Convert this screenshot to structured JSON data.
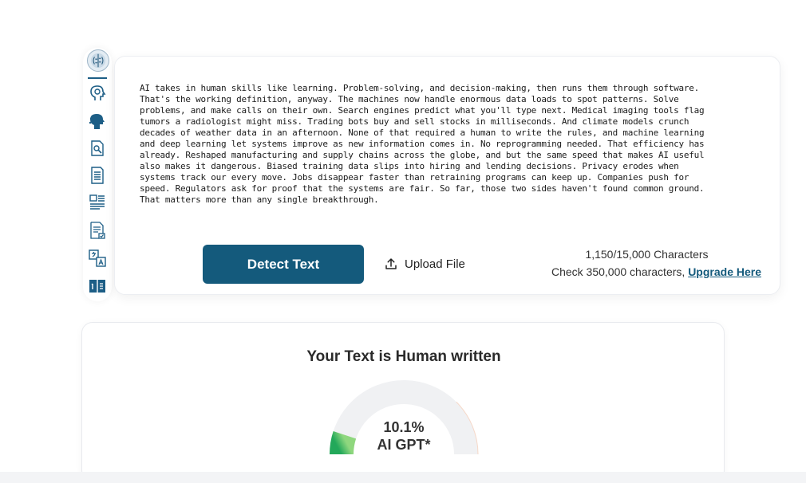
{
  "sidebar": {
    "icons": [
      {
        "name": "brain-logo-icon"
      },
      {
        "name": "ai-head-icon"
      },
      {
        "name": "humanize-icon"
      },
      {
        "name": "plagiarism-icon"
      },
      {
        "name": "document-icon"
      },
      {
        "name": "image-text-icon"
      },
      {
        "name": "document-check-icon"
      },
      {
        "name": "translate-icon"
      },
      {
        "name": "compare-icon"
      }
    ],
    "accent": "#145a7c"
  },
  "editor": {
    "text": "AI takes in human skills like learning. Problem-solving, and decision-making, then runs them through software.\nThat's the working definition, anyway. The machines now handle enormous data loads to spot patterns. Solve\nproblems, and make calls on their own. Search engines predict what you'll type next. Medical imaging tools flag\ntumors a radiologist might miss. Trading bots buy and sell stocks in milliseconds. And climate models crunch\ndecades of weather data in an afternoon. None of that required a human to write the rules, and machine learning\nand deep learning let systems improve as new information comes in. No reprogramming needed. That efficiency has\nalready. Reshaped manufacturing and supply chains across the globe, and but the same speed that makes AI useful\nalso makes it dangerous. Biased training data slips into hiring and lending decisions. Privacy erodes when\nsystems track our every move. Jobs disappear faster than retraining programs can keep up. Companies push for\nspeed. Regulators ask for proof that the systems are fair. So far, those two sides haven't found common ground.\nThat matters more than any single breakthrough.",
    "detect_label": "Detect Text",
    "upload_label": "Upload File",
    "char_count": "1,150/15,000 Characters",
    "check_text": "Check 350,000 characters, ",
    "upgrade_link": "Upgrade Here"
  },
  "result": {
    "title": "Your Text is Human written",
    "percent": "10.1%",
    "percent_value": 10.1,
    "label": "AI GPT*",
    "colors": {
      "track": "#f0f1f3",
      "ai": "#2fae6a",
      "ai_light": "#7bd27a"
    }
  }
}
